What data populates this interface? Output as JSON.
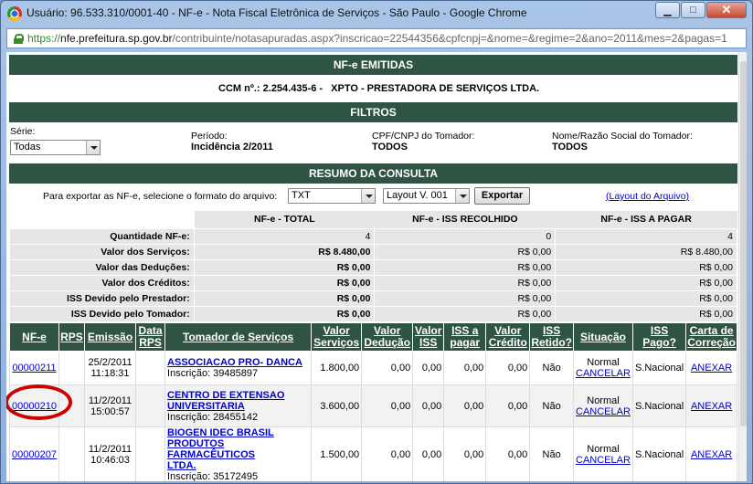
{
  "window": {
    "title": "Usuário: 96.533.310/0001-40 - NF-e - Nota Fiscal Eletrônica de Serviços - São Paulo - Google Chrome",
    "minimize": "▁",
    "maximize": "□",
    "close": "✕"
  },
  "address": {
    "scheme": "https://",
    "host": "nfe.prefeitura.sp.gov.br",
    "path": "/contribuinte/notasapuradas.aspx?inscricao=22544356&cpfcnpj=&nome=&regime=2&ano=2011&mes=2&pagas=1"
  },
  "header": {
    "title": "NF-e EMITIDAS",
    "ccm_label": "CCM nº.:",
    "ccm_value": "2.254.435-6 -",
    "company": "XPTO - PRESTADORA DE SERVIÇOS LTDA."
  },
  "filters": {
    "title": "FILTROS",
    "serie_label": "Série:",
    "serie_value": "Todas",
    "periodo_label": "Período:",
    "periodo_value": "Incidência 2/2011",
    "cpf_label": "CPF/CNPJ do Tomador:",
    "cpf_value": "TODOS",
    "nome_label": "Nome/Razão Social do Tomador:",
    "nome_value": "TODOS"
  },
  "resumo": {
    "title": "RESUMO DA CONSULTA",
    "export_label": "Para exportar as NF-e, selecione o formato do arquivo:",
    "format_value": "TXT",
    "layout_value": "Layout V. 001",
    "export_button": "Exportar",
    "layout_link": "(Layout do Arquivo)",
    "col_total": "NF-e - TOTAL",
    "col_recolhido": "NF-e - ISS RECOLHIDO",
    "col_pagar": "NF-e - ISS A PAGAR",
    "rows": [
      {
        "label": "Quantidade NF-e:",
        "total": "4",
        "recolhido": "0",
        "pagar": "4"
      },
      {
        "label": "Valor dos Serviços:",
        "total": "R$ 8.480,00",
        "recolhido": "R$ 0,00",
        "pagar": "R$ 8.480,00"
      },
      {
        "label": "Valor das Deduções:",
        "total": "R$ 0,00",
        "recolhido": "R$ 0,00",
        "pagar": "R$ 0,00"
      },
      {
        "label": "Valor dos Créditos:",
        "total": "R$ 0,00",
        "recolhido": "R$ 0,00",
        "pagar": "R$ 0,00"
      },
      {
        "label": "ISS Devido pelo Prestador:",
        "total": "R$ 0,00",
        "recolhido": "R$ 0,00",
        "pagar": "R$ 0,00"
      },
      {
        "label": "ISS Devido pelo Tomador:",
        "total": "R$ 0,00",
        "recolhido": "R$ 0,00",
        "pagar": "R$ 0,00"
      }
    ]
  },
  "notas": {
    "headers": {
      "nfe": "NF-e",
      "rps": "RPS",
      "emissao": "Emissão",
      "data_rps_1": "Data",
      "data_rps_2": "RPS",
      "tomador": "Tomador de Serviços",
      "vs_1": "Valor",
      "vs_2": "Serviços",
      "vd_1": "Valor",
      "vd_2": "Dedução",
      "viss_1": "Valor",
      "viss_2": "ISS",
      "iss_pagar_1": "ISS a",
      "iss_pagar_2": "pagar",
      "vc_1": "Valor",
      "vc_2": "Crédito",
      "iss_ret_1": "ISS",
      "iss_ret_2": "Retido?",
      "situacao": "Situação",
      "iss_pago_1": "ISS",
      "iss_pago_2": "Pago?",
      "carta_1": "Carta de",
      "carta_2": "Correção"
    },
    "rows": [
      {
        "numero": "00000211",
        "emissao_data": "25/2/2011",
        "emissao_hora": "11:18:31",
        "tomador_1": "ASSOCIACAO PRO- DANCA",
        "tomador_2": "",
        "tomador_3": "",
        "inscricao": "Inscrição: 39485897",
        "valor": "1.800,00",
        "deducao": "0,00",
        "iss": "0,00",
        "iss_pagar": "0,00",
        "credito": "0,00",
        "retido": "Não",
        "situacao": "Normal",
        "cancelar": "CANCELAR",
        "pago": "S.Nacional",
        "anexar": "ANEXAR"
      },
      {
        "numero": "00000210",
        "emissao_data": "11/2/2011",
        "emissao_hora": "15:00:57",
        "tomador_1": "CENTRO DE EXTENSAO",
        "tomador_2": "UNIVERSITARIA",
        "tomador_3": "",
        "inscricao": "Inscrição: 28455142",
        "valor": "3.600,00",
        "deducao": "0,00",
        "iss": "0,00",
        "iss_pagar": "0,00",
        "credito": "0,00",
        "retido": "Não",
        "situacao": "Normal",
        "cancelar": "CANCELAR",
        "pago": "S.Nacional",
        "anexar": "ANEXAR"
      },
      {
        "numero": "00000207",
        "emissao_data": "11/2/2011",
        "emissao_hora": "10:46:03",
        "tomador_1": "BIOGEN IDEC BRASIL",
        "tomador_2": "PRODUTOS FARMACÊUTICOS",
        "tomador_3": "LTDA.",
        "inscricao": "Inscrição: 35172495",
        "valor": "1.500,00",
        "deducao": "0,00",
        "iss": "0,00",
        "iss_pagar": "0,00",
        "credito": "0,00",
        "retido": "Não",
        "situacao": "Normal",
        "cancelar": "CANCELAR",
        "pago": "S.Nacional",
        "anexar": "ANEXAR"
      }
    ]
  },
  "colors": {
    "header_green": "#2f5444",
    "link_blue": "#0000cc",
    "highlight_red": "#cc0000"
  }
}
